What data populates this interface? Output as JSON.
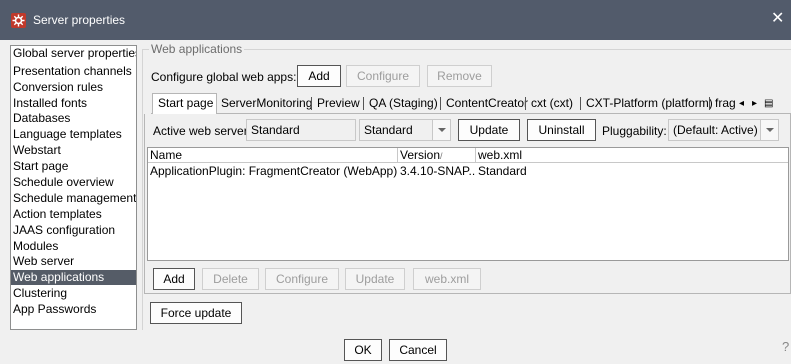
{
  "window": {
    "title": "Server properties",
    "app_icon": "gear-icon",
    "close_glyph": "✕"
  },
  "sidebar": {
    "items": [
      "Global server properties",
      "Presentation channels",
      "Conversion rules",
      "Installed fonts",
      "Databases",
      "Language templates",
      "Webstart",
      "Start page",
      "Schedule overview",
      "Schedule management",
      "Action templates",
      "JAAS configuration",
      "Modules",
      "Web server",
      "Web applications",
      "Clustering",
      "App Passwords"
    ],
    "selected": "Web applications"
  },
  "group": {
    "title": "Web applications"
  },
  "global_apps": {
    "label": "Configure global web apps:",
    "add": "Add",
    "configure": "Configure",
    "remove": "Remove"
  },
  "tabs": {
    "items": [
      "Start page",
      "ServerMonitoring",
      "Preview",
      "QA (Staging)",
      "ContentCreator",
      "cxt (cxt)",
      "CXT-Platform (platform)",
      "fragı"
    ],
    "active": "Start page",
    "nav": {
      "left": "◂",
      "right": "▸",
      "menu": "▤"
    }
  },
  "web_server": {
    "label": "Active web server:",
    "value": "Standard",
    "select_value": "Standard",
    "update": "Update",
    "uninstall": "Uninstall",
    "pluggability_label": "Pluggability:",
    "pluggability_value": "(Default: Active)"
  },
  "table": {
    "columns": [
      "Name",
      "Version",
      "web.xml"
    ],
    "sort_glyph": "/",
    "rows": [
      [
        "ApplicationPlugin: FragmentCreator (WebApp)",
        "3.4.10-SNAP...",
        "Standard"
      ]
    ]
  },
  "table_actions": {
    "add": "Add",
    "delete": "Delete",
    "configure": "Configure",
    "update": "Update",
    "webxml": "web.xml"
  },
  "force_update": "Force update",
  "footer": {
    "ok": "OK",
    "cancel": "Cancel",
    "help_glyph": "?"
  }
}
